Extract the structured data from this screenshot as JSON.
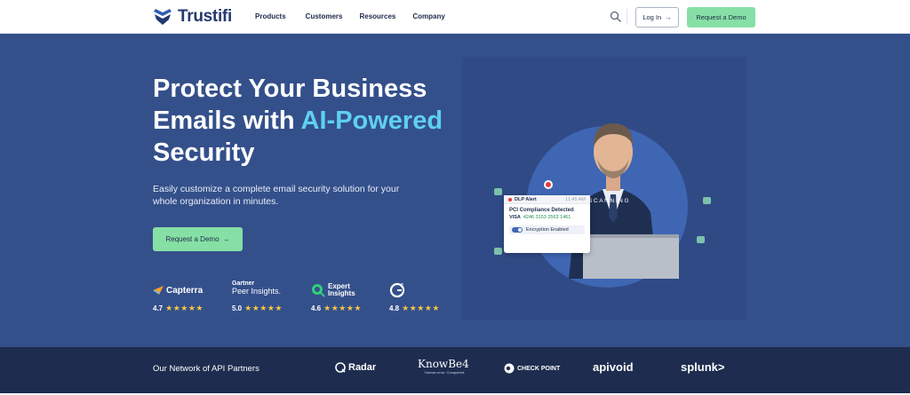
{
  "nav": {
    "brand": "Trustifi",
    "menu": [
      "Products",
      "Customers",
      "Resources",
      "Company"
    ],
    "login_label": "Log In",
    "demo_label": "Request a Demo"
  },
  "hero": {
    "headline_line1": "Protect Your Business",
    "headline_line2_prefix": "Emails with ",
    "headline_line2_accent": "AI-Powered",
    "headline_line3": "Security",
    "subheading": "Easily customize a complete email security solution for your whole organization in minutes.",
    "cta_label": "Request a Demo"
  },
  "ratings": [
    {
      "brand": "Capterra",
      "score": "4.7",
      "stars": "★★★★★"
    },
    {
      "brand_top": "Gartner",
      "brand_bottom": "Peer Insights.",
      "score": "5.0",
      "stars": "★★★★★"
    },
    {
      "brand_top": "Expert",
      "brand_bottom": "Insights",
      "score": "4.6",
      "stars": "★★★★★"
    },
    {
      "brand": "G2",
      "score": "4.8",
      "stars": "★★★★★"
    }
  ],
  "illustration": {
    "alert_title": "DLP Alert",
    "alert_time": "11:45 AM",
    "alert_detail": "PCI Compliance Detected",
    "card_brand": "VISA",
    "card_number": "4246 3153 2563 1461",
    "encryption_label": "Encryption Enabled",
    "scanning_label": "SCANNING"
  },
  "partners": {
    "label": "Our Network of API Partners",
    "logos": [
      "Radar",
      "KnowBe4",
      "CHECK POINT",
      "apivoid",
      "splunk>"
    ],
    "knowbe4_tagline": "Human error. Conquered."
  },
  "colors": {
    "hero_bg": "#34508b",
    "accent": "#5fd0ee",
    "cta": "#86e0a5",
    "partners_bg": "#1e2d4f"
  }
}
